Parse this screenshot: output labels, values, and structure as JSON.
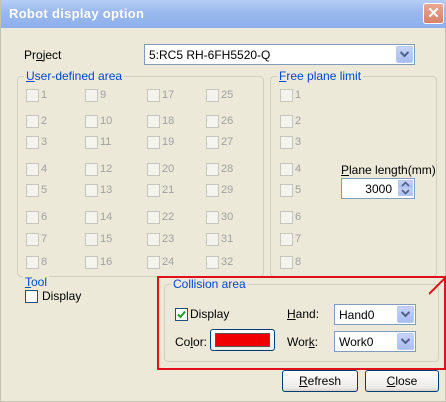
{
  "window": {
    "title": "Robot display option"
  },
  "project": {
    "label_pre": "Pr",
    "label_u": "o",
    "label_post": "ject",
    "value": "5:RC5 RH-6FH5520-Q"
  },
  "user_area": {
    "title_u": "U",
    "title_rest": "ser-defined area",
    "items": [
      "1",
      "9",
      "17",
      "25",
      "2",
      "10",
      "18",
      "26",
      "3",
      "11",
      "19",
      "27",
      "4",
      "12",
      "20",
      "28",
      "5",
      "13",
      "21",
      "29",
      "6",
      "14",
      "22",
      "30",
      "7",
      "15",
      "23",
      "31",
      "8",
      "16",
      "24",
      "32"
    ]
  },
  "free_plane": {
    "title_u": "F",
    "title_rest": "ree plane limit",
    "items": [
      "1",
      "2",
      "3",
      "4",
      "5",
      "6",
      "7",
      "8"
    ]
  },
  "plane_length": {
    "label_u": "P",
    "label_rest": "lane length(mm)",
    "value": "3000"
  },
  "tool": {
    "title_u": "T",
    "title_rest": "ool",
    "display_label": "Display",
    "checked": false
  },
  "collision": {
    "title": "Collision area",
    "display_label": "Display",
    "display_checked": true,
    "color_label_pre": "Co",
    "color_label_u": "l",
    "color_label_post": "or:",
    "color_value": "#f00000",
    "hand_label_u": "H",
    "hand_label_rest": "and:",
    "hand_value": "Hand0",
    "work_label_pre": "Wor",
    "work_label_u": "k",
    "work_label_post": ":",
    "work_value": "Work0"
  },
  "buttons": {
    "refresh_u": "R",
    "refresh_rest": "efresh",
    "close_u": "C",
    "close_rest": "lose"
  },
  "annotation": {
    "color": "#e0101a"
  }
}
